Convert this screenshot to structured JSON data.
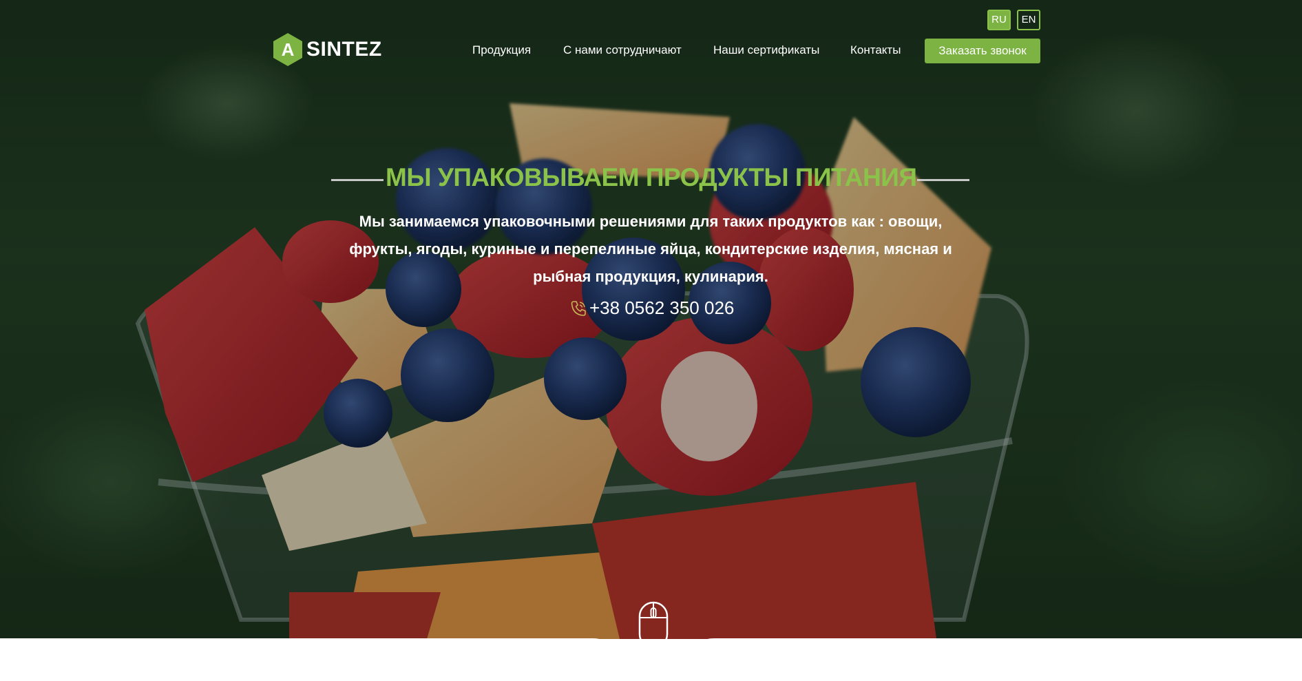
{
  "header": {
    "logo_letter": "A",
    "logo_text": "SINTEZ",
    "lang": {
      "ru": "RU",
      "en": "EN"
    },
    "nav": [
      {
        "label": "Продукция"
      },
      {
        "label": "С нами сотрудничают"
      },
      {
        "label": "Наши сертификаты"
      },
      {
        "label": "Контакты"
      }
    ],
    "cta_label": "Заказать звонок"
  },
  "hero": {
    "title": "МЫ УПАКОВЫВАЕМ ПРОДУКТЫ ПИТАНИЯ",
    "description": "Мы занимаемся упаковочными решениями для таких продуктов как : овощи, фрукты, ягоды, куриные и перепелиные яйца, кондитерские изделия, мясная и рыбная продукция, кулинария.",
    "phone": "+38 0562 350 026",
    "phone_icon": "phone-icon",
    "scroll_icon": "mouse-scroll-icon"
  },
  "colors": {
    "accent": "#7cb342",
    "title": "#8bc34a",
    "text": "#ffffff"
  }
}
